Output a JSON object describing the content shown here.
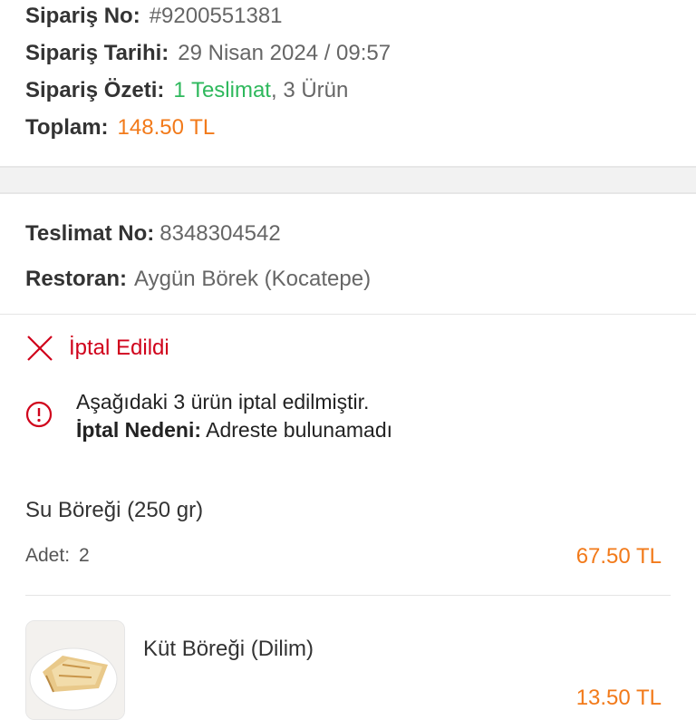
{
  "order": {
    "number_label": "Sipariş No:",
    "number_value": "#9200551381",
    "date_label": "Sipariş Tarihi:",
    "date_value": "29 Nisan 2024 / 09:57",
    "summary_label": "Sipariş Özeti:",
    "summary_deliveries": "1 Teslimat",
    "summary_items": ", 3 Ürün",
    "total_label": "Toplam:",
    "total_value": "148.50 TL"
  },
  "delivery": {
    "number_label": "Teslimat No:",
    "number_value": "8348304542",
    "restaurant_label": "Restoran:",
    "restaurant_value": "Aygün Börek (Kocatepe)"
  },
  "status": {
    "text": "İptal Edildi",
    "color": "#d0021b",
    "info_line1": "Aşağıdaki 3 ürün iptal edilmiştir.",
    "reason_label": "İptal Nedeni:",
    "reason_value": "Adreste bulunamadı"
  },
  "items": [
    {
      "name": "Su Böreği (250 gr)",
      "qty_label": "Adet:",
      "qty_value": "2",
      "price": "67.50 TL"
    },
    {
      "name": "Küt Böreği (Dilim)",
      "price_partial": "13.50 TL"
    }
  ],
  "colors": {
    "accent": "#f27a1a",
    "success": "#2eb85c",
    "danger": "#d0021b"
  }
}
